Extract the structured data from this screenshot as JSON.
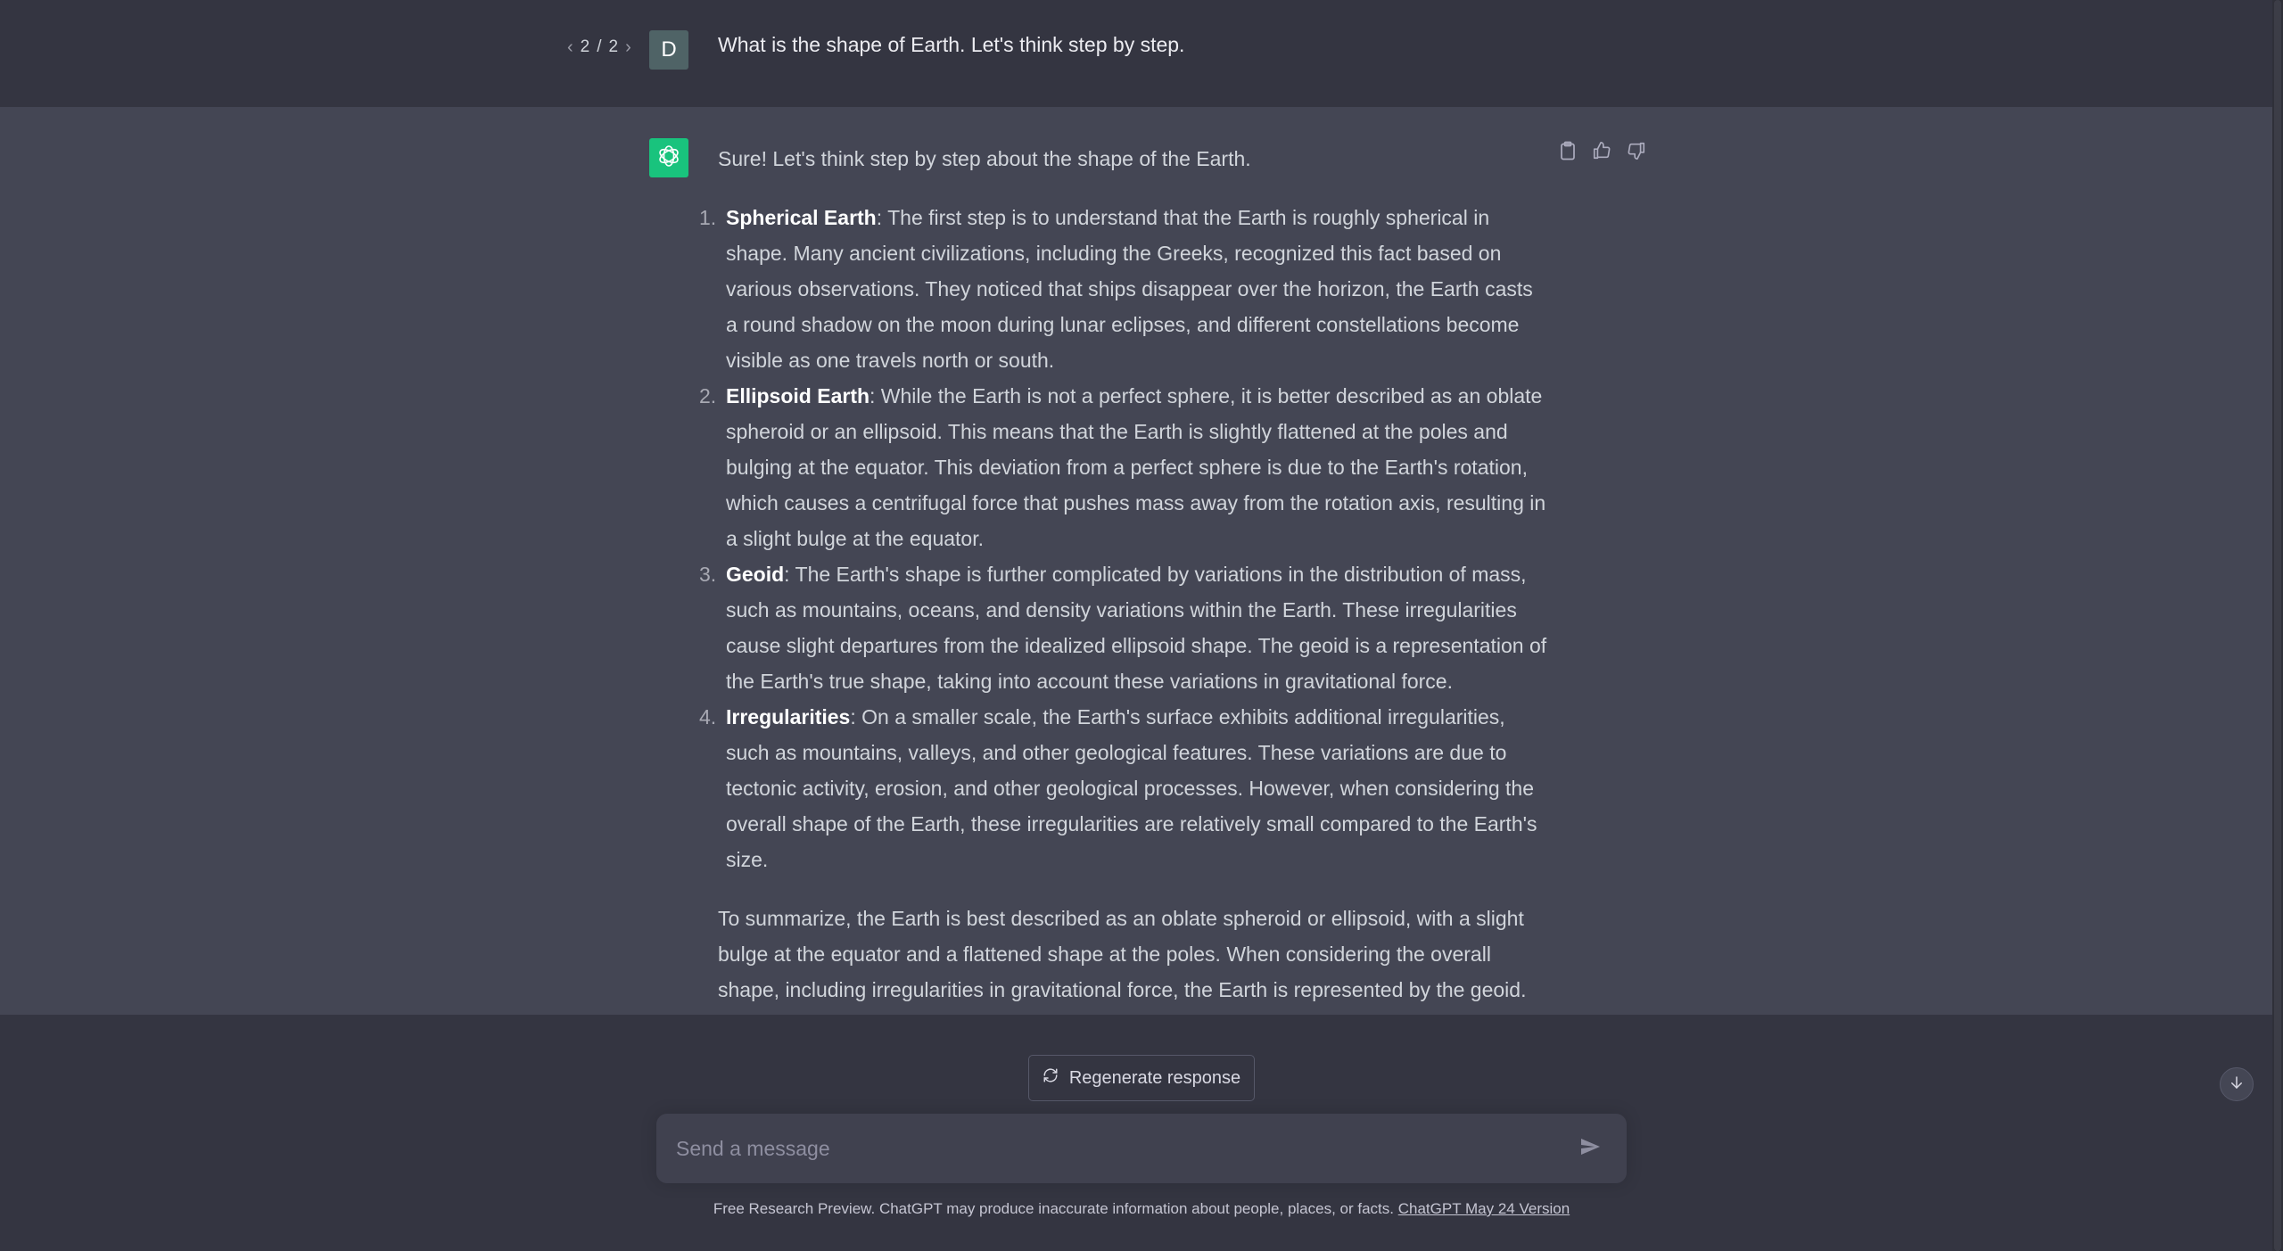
{
  "user_turn": {
    "pager": {
      "current": "2",
      "total": "2",
      "separator": "/"
    },
    "avatar_initial": "D",
    "message": "What is the shape of Earth. Let's think step by step."
  },
  "assistant_turn": {
    "intro": "Sure! Let's think step by step about the shape of the Earth.",
    "items": [
      {
        "number": "1.",
        "title": "Spherical Earth",
        "text": ": The first step is to understand that the Earth is roughly spherical in shape. Many ancient civilizations, including the Greeks, recognized this fact based on various observations. They noticed that ships disappear over the horizon, the Earth casts a round shadow on the moon during lunar eclipses, and different constellations become visible as one travels north or south."
      },
      {
        "number": "2.",
        "title": "Ellipsoid Earth",
        "text": ": While the Earth is not a perfect sphere, it is better described as an oblate spheroid or an ellipsoid. This means that the Earth is slightly flattened at the poles and bulging at the equator. This deviation from a perfect sphere is due to the Earth's rotation, which causes a centrifugal force that pushes mass away from the rotation axis, resulting in a slight bulge at the equator."
      },
      {
        "number": "3.",
        "title": "Geoid",
        "text": ": The Earth's shape is further complicated by variations in the distribution of mass, such as mountains, oceans, and density variations within the Earth. These irregularities cause slight departures from the idealized ellipsoid shape. The geoid is a representation of the Earth's true shape, taking into account these variations in gravitational force."
      },
      {
        "number": "4.",
        "title": "Irregularities",
        "text": ": On a smaller scale, the Earth's surface exhibits additional irregularities, such as mountains, valleys, and other geological features. These variations are due to tectonic activity, erosion, and other geological processes. However, when considering the overall shape of the Earth, these irregularities are relatively small compared to the Earth's size."
      }
    ],
    "summary": "To summarize, the Earth is best described as an oblate spheroid or ellipsoid, with a slight bulge at the equator and a flattened shape at the poles. When considering the overall shape, including irregularities in gravitational force, the Earth is represented by the geoid."
  },
  "actions": {
    "regenerate_label": "Regenerate response"
  },
  "composer": {
    "placeholder": "Send a message",
    "value": ""
  },
  "footer": {
    "note": "Free Research Preview. ChatGPT may produce inaccurate information about people, places, or facts. ",
    "link": "ChatGPT May 24 Version"
  },
  "icons": {
    "sidebar_toggle": "sidebar-toggle-icon",
    "gpt_logo": "openai-logo-icon",
    "copy": "clipboard-icon",
    "thumbs_up": "thumbs-up-icon",
    "thumbs_down": "thumbs-down-icon",
    "regenerate": "refresh-icon",
    "send": "send-icon",
    "scroll_down": "arrow-down-icon"
  },
  "colors": {
    "background": "#343541",
    "assistant_background": "#444654",
    "brand_green": "#19c37d",
    "composer_background": "#40414f"
  }
}
